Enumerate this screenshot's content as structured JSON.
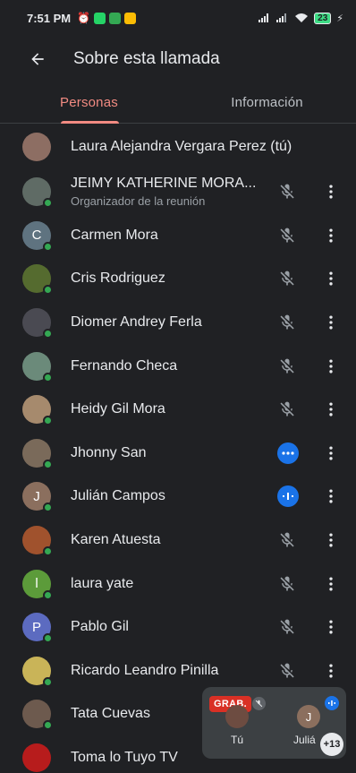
{
  "status": {
    "time": "7:51 PM",
    "battery": "23",
    "app_icons": [
      {
        "name": "alarm-off-icon",
        "color": "#e8eaed"
      },
      {
        "name": "whatsapp-icon",
        "color": "#25d366"
      },
      {
        "name": "messages-icon",
        "color": "#34a853"
      },
      {
        "name": "photos-icon",
        "color": "#fbbc04"
      }
    ]
  },
  "app_bar": {
    "title": "Sobre esta llamada"
  },
  "tabs": [
    {
      "label": "Personas",
      "active": true
    },
    {
      "label": "Información",
      "active": false
    }
  ],
  "participants": [
    {
      "name": "Laura Alejandra Vergara Perez (tú)",
      "subtitle": "",
      "avatar_letter": "",
      "avatar_color": "#8d6e63",
      "state": "none",
      "presence": false
    },
    {
      "name": "JEIMY KATHERINE MORA...",
      "subtitle": "Organizador de la reunión",
      "avatar_letter": "",
      "avatar_color": "#5f6b65",
      "state": "muted",
      "presence": true
    },
    {
      "name": "Carmen Mora",
      "subtitle": "",
      "avatar_letter": "C",
      "avatar_color": "#5f7380",
      "state": "muted",
      "presence": true
    },
    {
      "name": "Cris Rodriguez",
      "subtitle": "",
      "avatar_letter": "",
      "avatar_color": "#556b2f",
      "state": "muted",
      "presence": true
    },
    {
      "name": "Diomer Andrey Ferla",
      "subtitle": "",
      "avatar_letter": "",
      "avatar_color": "#4a4a52",
      "state": "muted",
      "presence": true
    },
    {
      "name": "Fernando Checa",
      "subtitle": "",
      "avatar_letter": "",
      "avatar_color": "#6b8a7a",
      "state": "muted",
      "presence": true
    },
    {
      "name": "Heidy Gil Mora",
      "subtitle": "",
      "avatar_letter": "",
      "avatar_color": "#a68a6d",
      "state": "muted",
      "presence": true
    },
    {
      "name": "Jhonny San",
      "subtitle": "",
      "avatar_letter": "",
      "avatar_color": "#7a6a5a",
      "state": "connecting",
      "presence": true
    },
    {
      "name": "Julián Campos",
      "subtitle": "",
      "avatar_letter": "J",
      "avatar_color": "#8b6f5e",
      "state": "speaking",
      "presence": true
    },
    {
      "name": "Karen Atuesta",
      "subtitle": "",
      "avatar_letter": "",
      "avatar_color": "#a0522d",
      "state": "muted",
      "presence": true
    },
    {
      "name": "laura yate",
      "subtitle": "",
      "avatar_letter": "l",
      "avatar_color": "#5c9b3a",
      "state": "muted",
      "presence": true
    },
    {
      "name": "Pablo Gil",
      "subtitle": "",
      "avatar_letter": "P",
      "avatar_color": "#5c6bc0",
      "state": "muted",
      "presence": true
    },
    {
      "name": "Ricardo Leandro Pinilla",
      "subtitle": "",
      "avatar_letter": "",
      "avatar_color": "#c9b458",
      "state": "muted",
      "presence": true
    },
    {
      "name": "Tata Cuevas",
      "subtitle": "",
      "avatar_letter": "",
      "avatar_color": "#6d5a4e",
      "state": "none",
      "presence": true
    },
    {
      "name": "Toma lo Tuyo TV",
      "subtitle": "",
      "avatar_letter": "",
      "avatar_color": "#b71c1c",
      "state": "none",
      "presence": false
    }
  ],
  "pip": {
    "recording_badge": "GRAB.",
    "self_label": "Tú",
    "self_avatar_color": "#6d4c41",
    "other_label": "Juliá",
    "other_letter": "J",
    "other_avatar_color": "#8b6f5e",
    "more_count": "+13"
  }
}
